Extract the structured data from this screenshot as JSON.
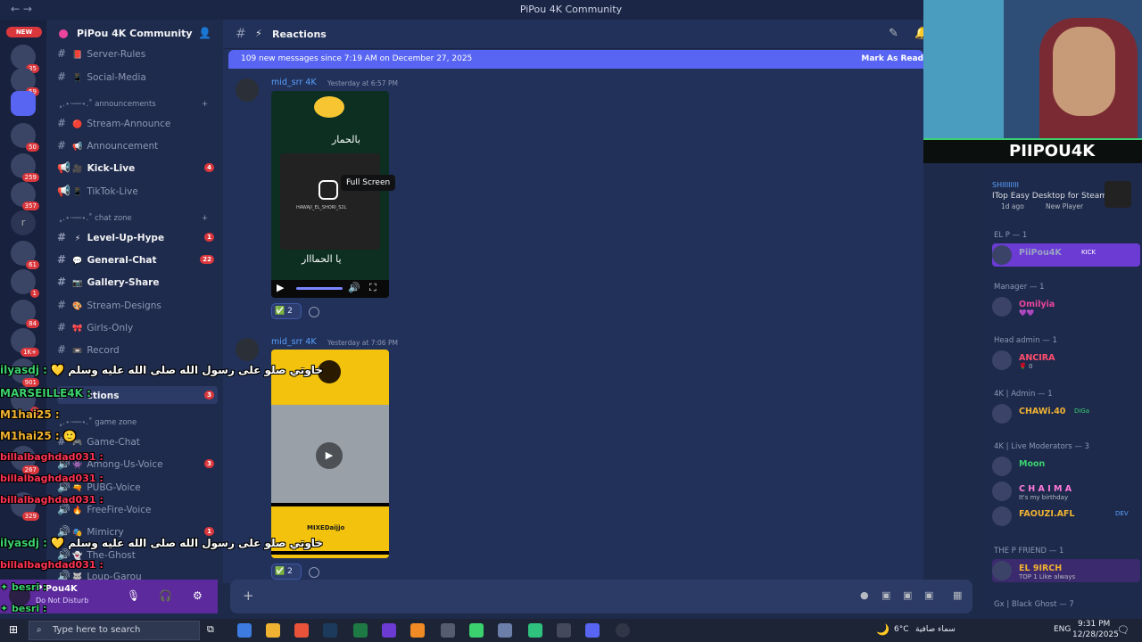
{
  "window": {
    "title": "PiPou 4K Community"
  },
  "servers": {
    "new_label": "NEW",
    "badges": [
      "35",
      "59",
      "50",
      "259",
      "357",
      "61",
      "1",
      "84",
      "1K+",
      "901",
      "9",
      "267",
      "329"
    ]
  },
  "sidebar": {
    "guild_name": "PiPou 4K Community",
    "categories": {
      "announcements": "announcements",
      "chat_zone": "chat zone",
      "game_zone": "game zone"
    },
    "channels": [
      {
        "name": "Server-Rules",
        "emoji": "📕",
        "count": ""
      },
      {
        "name": "Social-Media",
        "emoji": "📱",
        "count": ""
      },
      {
        "name": "Stream-Announce",
        "emoji": "🔴",
        "count": ""
      },
      {
        "name": "Announcement",
        "emoji": "📢",
        "count": ""
      },
      {
        "name": "Kick-Live",
        "emoji": "🎥",
        "count": "4"
      },
      {
        "name": "TikTok-Live",
        "emoji": "📱",
        "count": ""
      },
      {
        "name": "Level-Up-Hype",
        "emoji": "⚡",
        "count": "1"
      },
      {
        "name": "General-Chat",
        "emoji": "💬",
        "count": "22"
      },
      {
        "name": "Gallery-Share",
        "emoji": "📷",
        "count": ""
      },
      {
        "name": "Stream-Designs",
        "emoji": "🎨",
        "count": ""
      },
      {
        "name": "Girls-Only",
        "emoji": "🎀",
        "count": ""
      },
      {
        "name": "Record",
        "emoji": "📼",
        "count": ""
      },
      {
        "name": "ctions",
        "emoji": "⚡",
        "count": "3"
      },
      {
        "name": "Game-Chat",
        "emoji": "🎮",
        "count": ""
      },
      {
        "name": "Among-Us-Voice",
        "emoji": "👾",
        "count": "3"
      },
      {
        "name": "PUBG-Voice",
        "emoji": "🔫",
        "count": ""
      },
      {
        "name": "FreeFire-Voice",
        "emoji": "🔥",
        "count": ""
      },
      {
        "name": "Mimicry",
        "emoji": "🎭",
        "count": "1"
      },
      {
        "name": "The-Ghost",
        "emoji": "👻",
        "count": ""
      },
      {
        "name": "Loup-Garou",
        "emoji": "🐺",
        "count": ""
      }
    ]
  },
  "user": {
    "name": "PiPou4K",
    "status": "Do Not Disturb"
  },
  "channel": {
    "name": "Reactions",
    "emoji": "⚡"
  },
  "banner": {
    "text": "109 new messages since 7:19 AM on December 27, 2025",
    "action": "Mark As Read"
  },
  "messages": [
    {
      "author": "mid_srr 4K",
      "time": "Yesterday at 6:57 PM",
      "reaction_count": "2",
      "tooltip": "Full Screen",
      "video_text_top": "بالحمار",
      "video_text_bottom": "يا الحمااار",
      "video_caption": "HAWAJI_EL_SHORI_S2L"
    },
    {
      "author": "mid_srr 4K",
      "time": "Yesterday at 7:06 PM",
      "reaction_count": "2",
      "media_caption": "MIXEDaijjo"
    }
  ],
  "members": {
    "activity": {
      "user": "SHIIIIIIII",
      "game": "ITop Easy Desktop for Steam",
      "meta": "1d ago",
      "player": "New Player"
    },
    "groups": [
      {
        "title": "EL P — 1",
        "members": [
          {
            "name": "PiiPou4K",
            "status": "KICK",
            "color": "#9aa3c4"
          }
        ]
      },
      {
        "title": "Manager — 1",
        "members": [
          {
            "name": "Omilyia",
            "status": "💜💜",
            "color": "#eb459e"
          }
        ]
      },
      {
        "title": "Head admin — 1",
        "members": [
          {
            "name": "ANCIRA",
            "status": "🌹 0",
            "color": "#ff4d6d"
          }
        ]
      },
      {
        "title": "4K | Admin — 1",
        "members": [
          {
            "name": "CHAWi.40",
            "status": "DiGa",
            "color": "#f0b232"
          }
        ]
      },
      {
        "title": "4K | Live Moderators — 3",
        "members": [
          {
            "name": "Moon",
            "status": "",
            "color": "#3bd16f"
          },
          {
            "name": "C H A I M A",
            "status": "It's my birthday",
            "color": "#ff7ad9"
          },
          {
            "name": "FAOUZI.AFL",
            "status": "DEV",
            "color": "#f0b232"
          }
        ]
      },
      {
        "title": "THE P FRIEND — 1",
        "members": [
          {
            "name": "EL 9IRCH",
            "status": "TOP 1 Like always",
            "color": "#f0b232"
          }
        ]
      },
      {
        "title": "Gx | Black Ghost — 7",
        "members": []
      }
    ]
  },
  "webcam": {
    "brand": "PIIPOU4K"
  },
  "overlay_chat": [
    {
      "user": "ilyasdj",
      "text": "خاوتي صلو على رسول الله صلى الله عليه وسلم",
      "color": "#3bd16f"
    },
    {
      "user": "MARSEILLE4K",
      "text": "",
      "color": "#3bd16f"
    },
    {
      "user": "M1hai25",
      "text": "",
      "color": "#f0b232"
    },
    {
      "user": "M1hai25",
      "text": "",
      "color": "#f0b232"
    },
    {
      "user": "billalbaghdad031",
      "text": "",
      "color": "#ff3355"
    },
    {
      "user": "billalbaghdad031",
      "text": "",
      "color": "#ff3355"
    },
    {
      "user": "billalbaghdad031",
      "text": "",
      "color": "#ff3355"
    },
    {
      "user": "ilyasdj",
      "text": "خاوتي صلو على رسول الله صلى الله عليه وسلم",
      "color": "#3bd16f"
    },
    {
      "user": "billalbaghdad031",
      "text": "",
      "color": "#ff3355"
    },
    {
      "user": "besri",
      "text": "",
      "color": "#3bd16f"
    },
    {
      "user": "besri",
      "text": "",
      "color": "#3bd16f"
    }
  ],
  "taskbar": {
    "search_placeholder": "Type here to search",
    "weather": "6°C",
    "weather_desc": "سماء صافية",
    "lang": "ENG",
    "time": "9:31 PM",
    "date": "12/28/2025"
  }
}
